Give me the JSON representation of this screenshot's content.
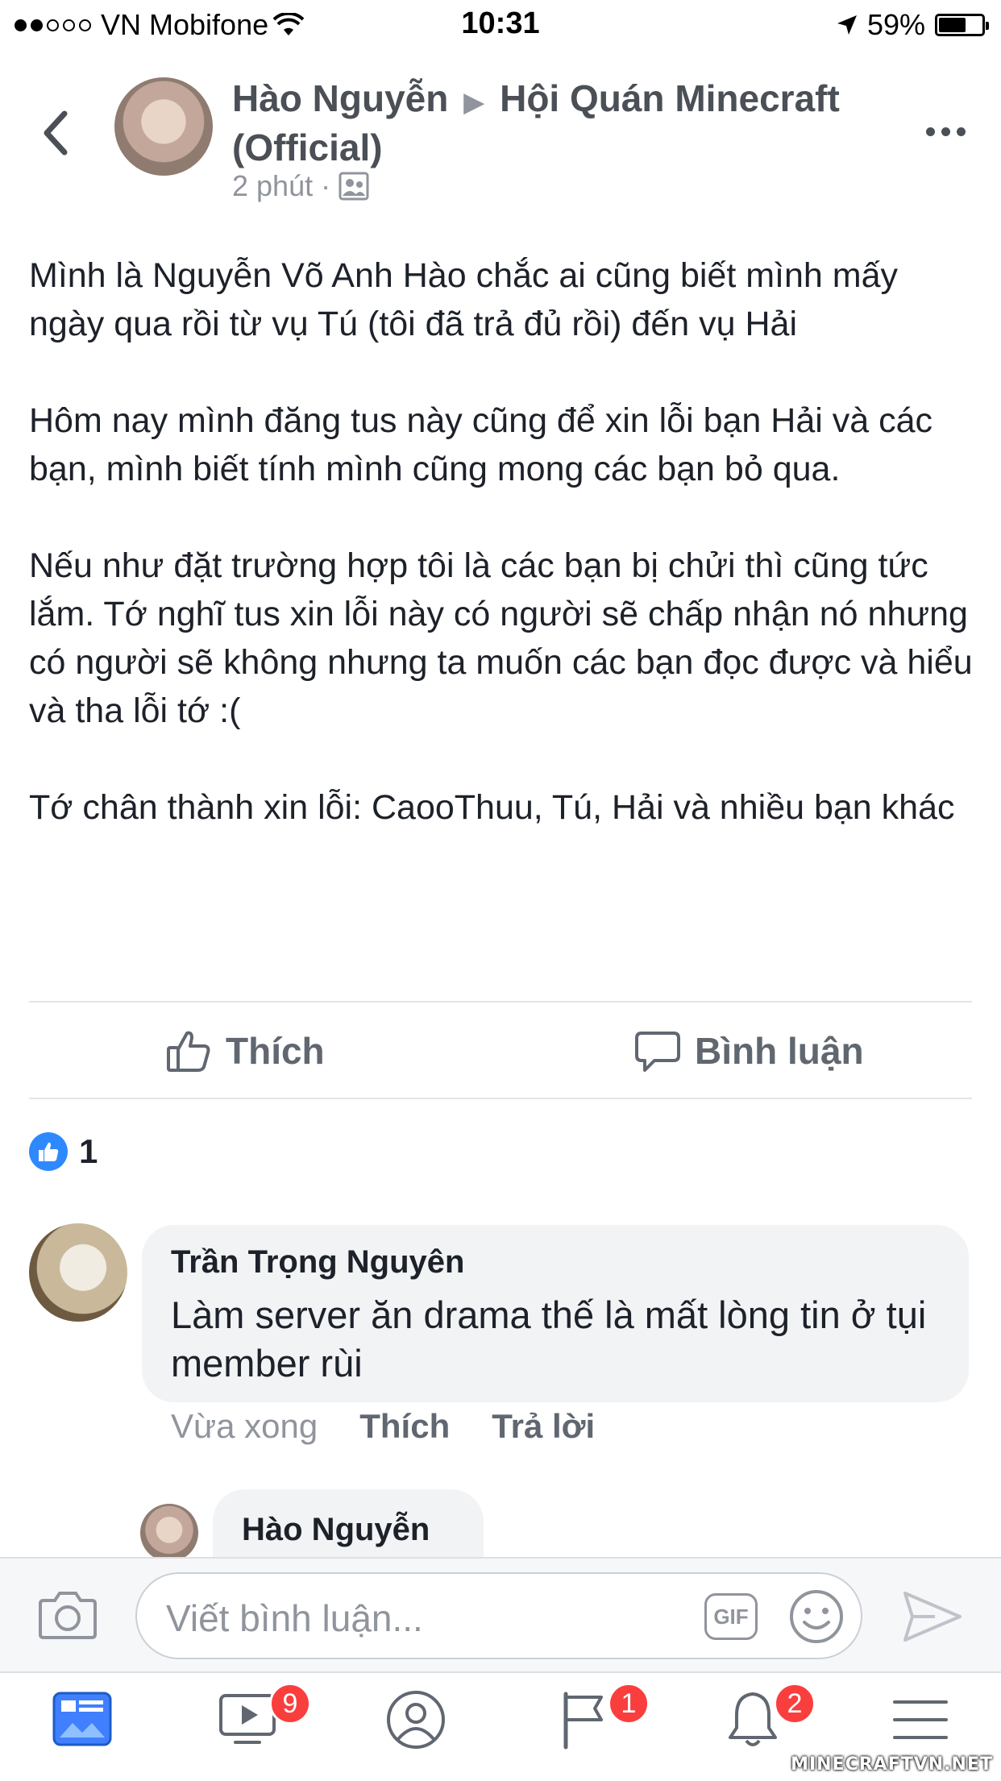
{
  "status_bar": {
    "carrier": "VN Mobifone",
    "time": "10:31",
    "battery": "59%",
    "signal_bars": 2,
    "battery_level": 0.59
  },
  "post": {
    "author": "Hào Nguyễn",
    "group": "Hội Quán Minecraft (Official)",
    "time": "2 phút",
    "paragraphs": [
      "Mình là Nguyễn Võ Anh Hào chắc ai cũng biết mình mấy ngày qua rồi từ vụ Tú (tôi đã trả đủ rồi) đến vụ Hải",
      "Hôm nay mình đăng tus này cũng để xin lỗi bạn Hải và các bạn, mình biết tính mình cũng mong các bạn bỏ qua.",
      "Nếu như đặt trường hợp tôi là các bạn bị chửi thì cũng tức lắm. Tớ nghĩ tus xin lỗi này có người sẽ chấp nhận nó nhưng có người sẽ không nhưng ta muốn các bạn đọc được và hiểu và tha lỗi tớ :(",
      "Tớ chân thành xin lỗi: CaooThuu, Tú, Hải và nhiều bạn khác"
    ],
    "like_label": "Thích",
    "comment_label": "Bình luận",
    "reaction_count": "1"
  },
  "comment": {
    "author": "Trần Trọng Nguyên",
    "text": "Làm server ăn drama thế là mất lòng tin ở tụi member rùi",
    "time": "Vừa xong",
    "like": "Thích",
    "reply": "Trả lời"
  },
  "reply": {
    "author": "Hào Nguyễn"
  },
  "composer": {
    "placeholder": "Viết bình luận...",
    "gif_label": "GIF"
  },
  "tabbar": {
    "video_badge": "9",
    "groups_badge": "1",
    "notifications_badge": "2"
  },
  "watermark": "MINECRAFTVN.NET",
  "colors": {
    "accent": "#2e89ff",
    "badge": "#fa3e3e",
    "muted": "#90949c"
  }
}
